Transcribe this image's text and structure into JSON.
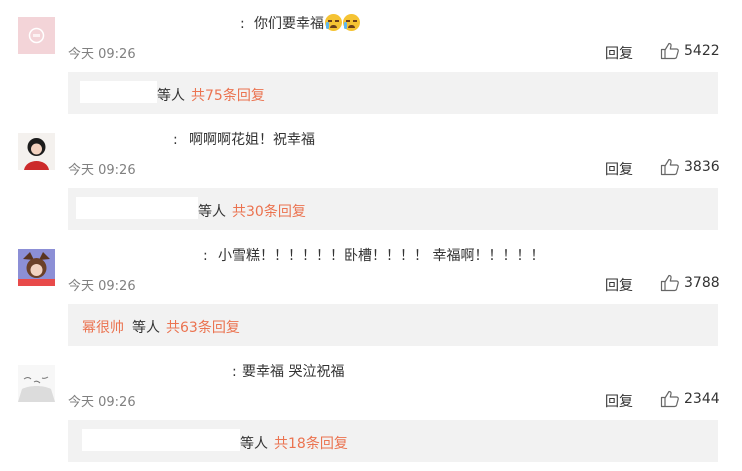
{
  "comments": [
    {
      "text": "你们要幸福",
      "emojis": [
        "crying-face",
        "crying-face"
      ],
      "time": "今天 09:26",
      "reply_label": "回复",
      "likes": "5422",
      "replies": {
        "etc": "等人",
        "total": "共75条回复"
      }
    },
    {
      "text": "啊啊啊花姐！祝幸福",
      "time": "今天 09:26",
      "reply_label": "回复",
      "likes": "3836",
      "replies": {
        "etc": "等人",
        "total": "共30条回复"
      }
    },
    {
      "text": "小雪糕！！！！！！卧槽！！！！ 幸福啊！！！！！",
      "time": "今天 09:26",
      "reply_label": "回复",
      "likes": "3788",
      "replies": {
        "replier": "幂很帅",
        "etc": "等人",
        "total": "共63条回复"
      }
    },
    {
      "text": "要幸福 哭泣祝福",
      "time": "今天 09:26",
      "reply_label": "回复",
      "likes": "2344",
      "replies": {
        "etc": "等人",
        "total": "共18条回复"
      }
    }
  ],
  "colors": {
    "link": "#eb7350",
    "reply_box_bg": "#f2f2f2",
    "text": "#333333",
    "muted": "#808080"
  },
  "icons": {
    "like": "thumbs-up-icon",
    "emoji": "crying-face-emoji"
  }
}
